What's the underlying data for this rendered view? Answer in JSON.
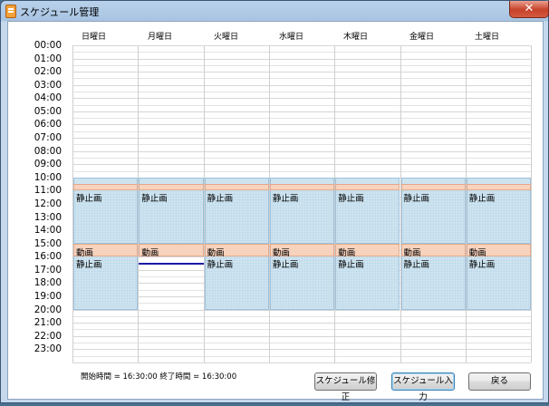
{
  "window": {
    "title": "スケジュール管理",
    "close_label": "✕"
  },
  "days": [
    "日曜日",
    "月曜日",
    "火曜日",
    "水曜日",
    "木曜日",
    "金曜日",
    "土曜日"
  ],
  "hours": [
    "00:00",
    "01:00",
    "02:00",
    "03:00",
    "04:00",
    "05:00",
    "06:00",
    "07:00",
    "08:00",
    "09:00",
    "10:00",
    "11:00",
    "12:00",
    "13:00",
    "14:00",
    "15:00",
    "16:00",
    "17:00",
    "18:00",
    "19:00",
    "20:00",
    "21:00",
    "22:00",
    "23:00"
  ],
  "schedule": {
    "still_label": "静止画",
    "motion_label": "動画",
    "entries": [
      {
        "type": "still",
        "start": "10:00",
        "end": "10:30",
        "days": [
          0,
          1,
          2,
          3,
          4,
          5,
          6
        ],
        "labeled": false
      },
      {
        "type": "motion",
        "start": "10:30",
        "end": "11:00",
        "days": [
          0,
          1,
          2,
          3,
          4,
          5,
          6
        ],
        "labeled": false
      },
      {
        "type": "still",
        "start": "11:00",
        "end": "15:00",
        "days": [
          0,
          1,
          2,
          3,
          4,
          5,
          6
        ],
        "labeled": true
      },
      {
        "type": "motion",
        "start": "15:00",
        "end": "16:00",
        "days": [
          0,
          1,
          2,
          3,
          4,
          5,
          6
        ],
        "labeled": true
      },
      {
        "type": "still",
        "start": "16:00",
        "end": "20:00",
        "days": [
          0,
          2,
          3,
          4,
          5,
          6
        ],
        "labeled": true
      }
    ],
    "selected_slot": {
      "day": 1,
      "time": "16:30"
    }
  },
  "status": {
    "text": "開始時間 = 16:30:00 終了時間 = 16:30:00"
  },
  "buttons": {
    "edit": "スケジュール修正",
    "input": "スケジュール入力",
    "back": "戻る"
  },
  "colors": {
    "still": "#cde3ef",
    "motion": "#f7d3be",
    "selection": "#1a1aa6"
  }
}
